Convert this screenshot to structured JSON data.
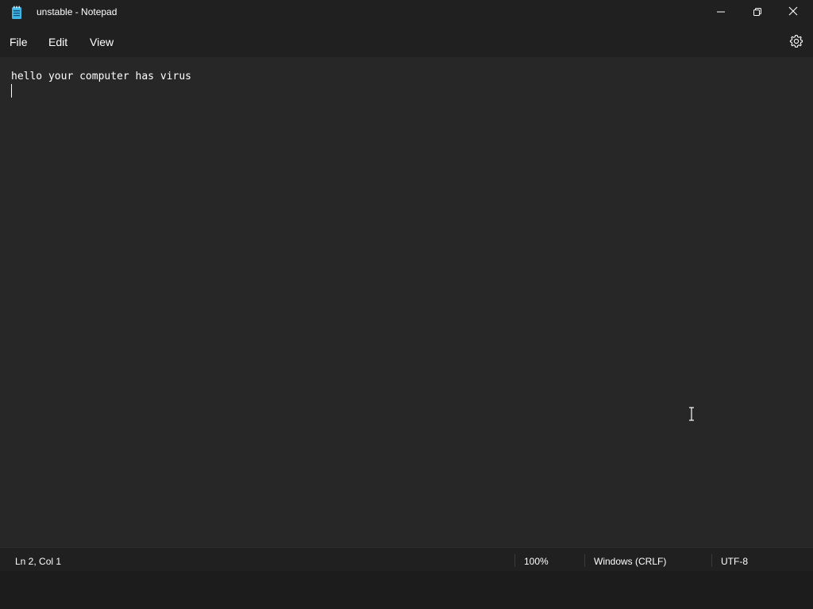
{
  "window": {
    "title": "unstable - Notepad",
    "app_icon": "notepad-icon"
  },
  "title_buttons": {
    "minimize_icon": "minimize-icon",
    "maximize_icon": "restore-icon",
    "close_icon": "close-icon"
  },
  "menu": {
    "items": [
      {
        "label": "File"
      },
      {
        "label": "Edit"
      },
      {
        "label": "View"
      }
    ],
    "settings_icon": "gear-icon"
  },
  "editor": {
    "lines": [
      "hello your computer has virus",
      ""
    ]
  },
  "status": {
    "position": "Ln 2, Col 1",
    "zoom": "100%",
    "line_ending": "Windows (CRLF)",
    "encoding": "UTF-8"
  },
  "colors": {
    "background": "#272727",
    "chrome": "#202020",
    "text": "#ffffff"
  }
}
